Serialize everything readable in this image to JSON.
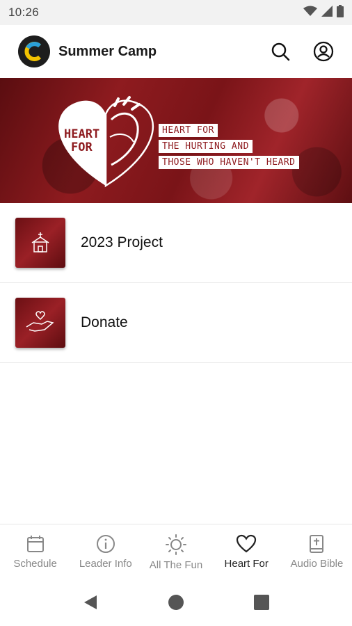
{
  "status_bar": {
    "time": "10:26",
    "icons": [
      "wifi-icon",
      "signal-icon",
      "battery-icon"
    ]
  },
  "app_bar": {
    "title": "Summer Camp",
    "logo_letter": "C",
    "actions": [
      "search-icon",
      "account-icon"
    ]
  },
  "banner": {
    "heart_line1": "HEART",
    "heart_line2": "FOR",
    "tags": [
      "HEART FOR",
      "THE HURTING AND",
      "THOSE WHO HAVEN'T HEARD"
    ]
  },
  "list": {
    "items": [
      {
        "label": "2023 Project",
        "icon": "church-icon"
      },
      {
        "label": "Donate",
        "icon": "giving-hand-icon"
      }
    ]
  },
  "bottom_nav": {
    "items": [
      {
        "label": "Schedule",
        "icon": "calendar-icon",
        "active": false
      },
      {
        "label": "Leader Info",
        "icon": "info-icon",
        "active": false
      },
      {
        "label": "All The Fun",
        "icon": "sun-icon",
        "active": false
      },
      {
        "label": "Heart For",
        "icon": "heart-icon",
        "active": true
      },
      {
        "label": "Audio Bible",
        "icon": "bible-icon",
        "active": false
      }
    ]
  },
  "colors": {
    "brand_red": "#8e1b1f",
    "inactive": "#888888",
    "active": "#222222"
  }
}
